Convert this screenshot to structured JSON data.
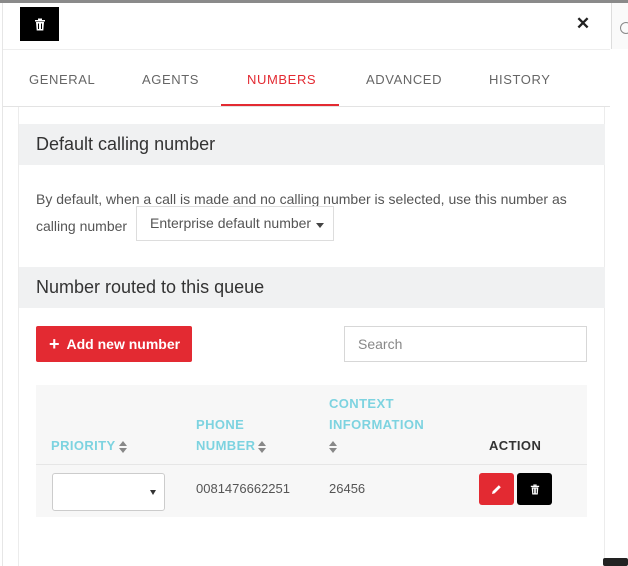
{
  "tabs": [
    {
      "label": "GENERAL"
    },
    {
      "label": "AGENTS"
    },
    {
      "label": "NUMBERS"
    },
    {
      "label": "ADVANCED"
    },
    {
      "label": "HISTORY"
    }
  ],
  "active_tab": "NUMBERS",
  "default_section": {
    "title": "Default calling number",
    "description": "By default, when a call is made and no calling number is selected, use this number as calling number",
    "selected_value": "Enterprise default number"
  },
  "routed_section": {
    "title": "Number routed to this queue",
    "add_button_label": "Add new number",
    "search_placeholder": "Search"
  },
  "table": {
    "headers": {
      "priority": "PRIORITY",
      "phone_number_line1": "PHONE",
      "phone_number_line2": "NUMBER",
      "context_line1": "CONTEXT",
      "context_line2": "INFORMATION",
      "action": "ACTION"
    },
    "rows": [
      {
        "priority": "",
        "phone_number": "0081476662251",
        "context": "26456"
      }
    ]
  },
  "colors": {
    "accent": "#e32a32",
    "header_cyan": "#7dd3e0",
    "section_bg": "#f0f1f2"
  },
  "icons": [
    "trash-icon",
    "close-icon",
    "clock-icon",
    "plus-icon",
    "sort-icon",
    "caret-down-icon",
    "pencil-icon"
  ]
}
